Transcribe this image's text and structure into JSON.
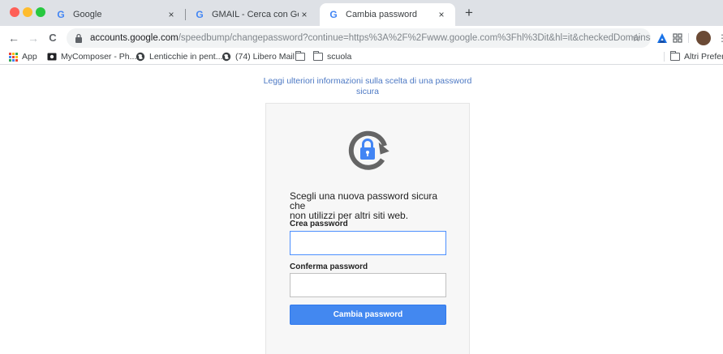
{
  "browser": {
    "tabs": [
      {
        "title": "Google",
        "favicon": "G"
      },
      {
        "title": "GMAIL - Cerca con Google",
        "favicon": "G"
      },
      {
        "title": "Cambia password",
        "favicon": "G"
      }
    ],
    "new_tab_label": "+",
    "close_label": "×",
    "url_host": "accounts.google.com",
    "url_path": "/speedbump/changepassword?continue=https%3A%2F%2Fwww.google.com%3Fhl%3Dit&hl=it&checkedDomains=yout...",
    "nav": {
      "back": "←",
      "forward": "→",
      "reload": "C"
    },
    "star": "☆",
    "menu": "⋮"
  },
  "bookmarks": {
    "items": [
      {
        "label": "App",
        "icon": "apps-grid-icon"
      },
      {
        "label": "MyComposer - Ph...",
        "icon": "mycomposer-icon"
      },
      {
        "label": "Lenticchie in pent...",
        "icon": "globe-icon"
      },
      {
        "label": "(74) Libero Mail",
        "icon": "globe-icon"
      },
      {
        "label": "",
        "icon": "folder-icon"
      },
      {
        "label": "scuola",
        "icon": "folder-icon"
      }
    ],
    "other": "Altri Preferiti"
  },
  "page": {
    "info_link_line1": "Leggi ulteriori informazioni sulla scelta di una password",
    "info_link_line2": "sicura",
    "intro_line1": "Scegli una nuova password sicura che",
    "intro_line2": "non utilizzi per altri siti web.",
    "create_label": "Crea password",
    "create_value": "",
    "confirm_label": "Conferma password",
    "confirm_value": "",
    "submit_label": "Cambia password"
  },
  "colors": {
    "link": "#4d79c4",
    "button": "#4388f0",
    "card_bg": "#f7f7f7",
    "icon_gray": "#656565",
    "icon_blue": "#4285f4"
  }
}
